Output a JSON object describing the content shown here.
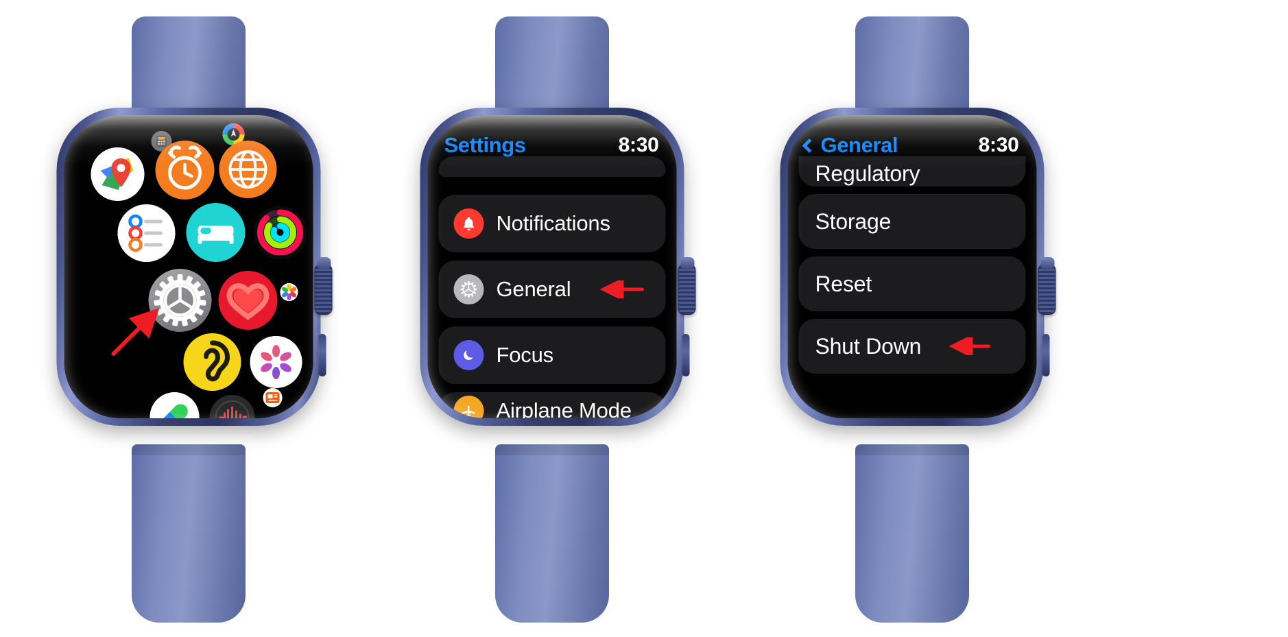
{
  "meta": {
    "device": "Apple Watch",
    "band_color": "#7482ba",
    "case_color": "#4a5790",
    "accent_blue": "#0a84ff",
    "row_bg": "#1c1c1e",
    "arrow_color": "#ee1d24",
    "screen_bg": "#000000"
  },
  "watch1": {
    "name": "Home Screen app grid",
    "apps": [
      {
        "name": "Calculator",
        "icon": "calculator-icon",
        "color": "#6e6e73"
      },
      {
        "name": "Compass",
        "icon": "compass-icon",
        "color": "#ffffff"
      },
      {
        "name": "Maps",
        "icon": "maps-icon",
        "color": "#ffffff"
      },
      {
        "name": "Alarms",
        "icon": "alarm-icon",
        "color": "#f57c1f"
      },
      {
        "name": "World Clock",
        "icon": "globe-icon",
        "color": "#f57c1f"
      },
      {
        "name": "Reminders",
        "icon": "reminders-icon",
        "color": "#ffffff"
      },
      {
        "name": "Sleep",
        "icon": "bed-icon",
        "color": "#21d4d4"
      },
      {
        "name": "Activity",
        "icon": "activity-rings-icon",
        "color": "#111111"
      },
      {
        "name": "Settings",
        "icon": "gear-icon",
        "color": "#86868b"
      },
      {
        "name": "Heart Rate",
        "icon": "heart-icon",
        "color": "#e8192c"
      },
      {
        "name": "Photos",
        "icon": "photos-icon",
        "color": "#ffffff"
      },
      {
        "name": "Noise",
        "icon": "ear-icon",
        "color": "#f5d618"
      },
      {
        "name": "Breathe",
        "icon": "mindfulness-icon",
        "color": "#ffffff"
      },
      {
        "name": "Medications",
        "icon": "pill-icon",
        "color": "#ffffff"
      },
      {
        "name": "Voice Memos",
        "icon": "waveform-icon",
        "color": "#2b2b2e"
      },
      {
        "name": "News",
        "icon": "news-icon",
        "color": "#f06014"
      }
    ],
    "annotation": {
      "type": "arrow",
      "points_to": "Settings",
      "color": "#ee1d24"
    }
  },
  "watch2": {
    "name": "Settings app",
    "nav": {
      "title": "Settings",
      "time": "8:30",
      "has_back": false
    },
    "rows": [
      {
        "label": "",
        "icon": "",
        "partial": "top"
      },
      {
        "label": "Notifications",
        "icon": "bell-icon",
        "icon_color": "#ff3b30"
      },
      {
        "label": "General",
        "icon": "gear-icon",
        "icon_color": "#b8b8bd",
        "annotated": true
      },
      {
        "label": "Focus",
        "icon": "moon-icon",
        "icon_color": "#5e5ce6"
      },
      {
        "label": "Airplane Mode",
        "icon": "airplane-icon",
        "icon_color": "#f5a623",
        "partial": "bottom"
      }
    ],
    "annotation": {
      "type": "arrow",
      "points_to": "General",
      "color": "#ee1d24"
    }
  },
  "watch3": {
    "name": "General settings",
    "nav": {
      "title": "General",
      "time": "8:30",
      "has_back": true
    },
    "rows": [
      {
        "label": "Regulatory",
        "partial": "top"
      },
      {
        "label": "Storage"
      },
      {
        "label": "Reset"
      },
      {
        "label": "Shut Down",
        "annotated": true
      }
    ],
    "annotation": {
      "type": "arrow",
      "points_to": "Shut Down",
      "color": "#ee1d24"
    }
  }
}
